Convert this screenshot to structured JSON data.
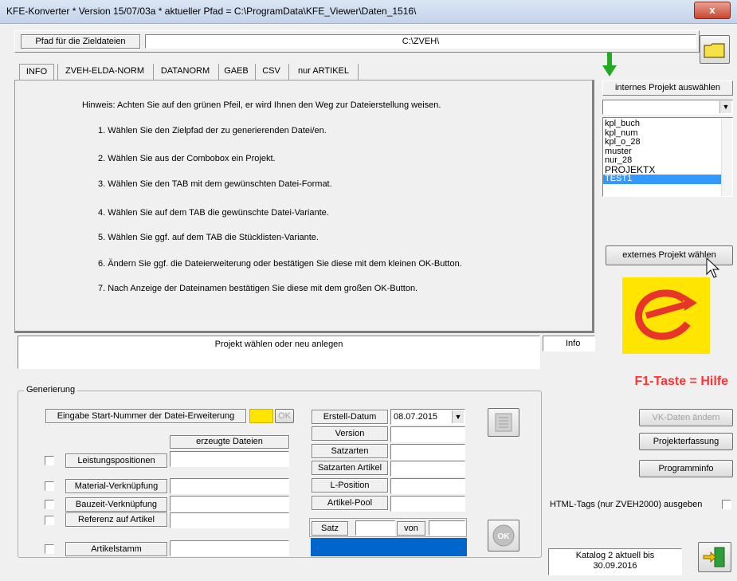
{
  "window": {
    "title": "KFE-Konverter * Version 15/07/03a * aktueller Pfad = C:\\ProgramData\\KFE_Viewer\\Daten_1516\\",
    "close_label": "x"
  },
  "path": {
    "label": "Pfad für die Zieldateien",
    "value": "C:\\ZVEH\\"
  },
  "tabs": [
    "INFO",
    "ZVEH-ELDA-NORM",
    "DATANORM",
    "GAEB",
    "CSV",
    "nur ARTIKEL"
  ],
  "info": {
    "hint": "Hinweis: Achten Sie auf den grünen Pfeil, er wird Ihnen den Weg zur Dateierstellung weisen.",
    "steps": [
      "1. Wählen Sie den Zielpfad der zu generierenden Datei/en.",
      "2. Wählen Sie aus der Combobox ein Projekt.",
      "3. Wählen Sie den TAB mit dem gewünschten Datei-Format.",
      "4. Wählen Sie auf dem TAB die gewünschte Datei-Variante.",
      "5. Wählen Sie ggf. auf dem TAB die Stücklisten-Variante.",
      "6. Ändern Sie ggf. die Dateierweiterung oder bestätigen Sie diese mit dem kleinen OK-Button.",
      "7. Nach Anzeige der Dateinamen bestätigen Sie diese mit dem großen OK-Button."
    ]
  },
  "project": {
    "internal_label": "internes Projekt auswählen",
    "list": [
      "kpl_buch",
      "kpl_num",
      "kpl_o_28",
      "muster",
      "nur_28",
      "PROJEKTX",
      "TEST1"
    ],
    "selected": "TEST1",
    "external_button": "externes Projekt wählen"
  },
  "status": {
    "message": "Projekt wählen oder neu anlegen",
    "info_label": "Info"
  },
  "help_text": "F1-Taste = Hilfe",
  "generation": {
    "group_label": "Generierung",
    "start_number_label": "Eingabe Start-Nummer der Datei-Erweiterung",
    "ok_small": "OK",
    "files_header": "erzeugte Dateien",
    "checks": [
      "Leistungspositionen",
      "Material-Verknüpfung",
      "Bauzeit-Verknüpfung",
      "Referenz auf Artikel",
      "Artikelstamm"
    ],
    "meta_labels": [
      "Erstell-Datum",
      "Version",
      "Satzarten",
      "Satzarten Artikel",
      "L-Position",
      "Artikel-Pool"
    ],
    "date_value": "08.07.2015",
    "satz_label": "Satz",
    "von_label": "von"
  },
  "side_buttons": [
    "VK-Daten ändern",
    "Projekterfassung",
    "Programminfo"
  ],
  "html_tags_label": "HTML-Tags (nur ZVEH2000) ausgeben",
  "catalog_text": "Katalog 2 aktuell bis 30.09.2016",
  "colors": {
    "accent_yellow": "#ffe500",
    "help_red": "#ff3333",
    "progress_blue": "#0066cc",
    "selection_blue": "#3399ff",
    "arrow_green": "#22aa22"
  }
}
